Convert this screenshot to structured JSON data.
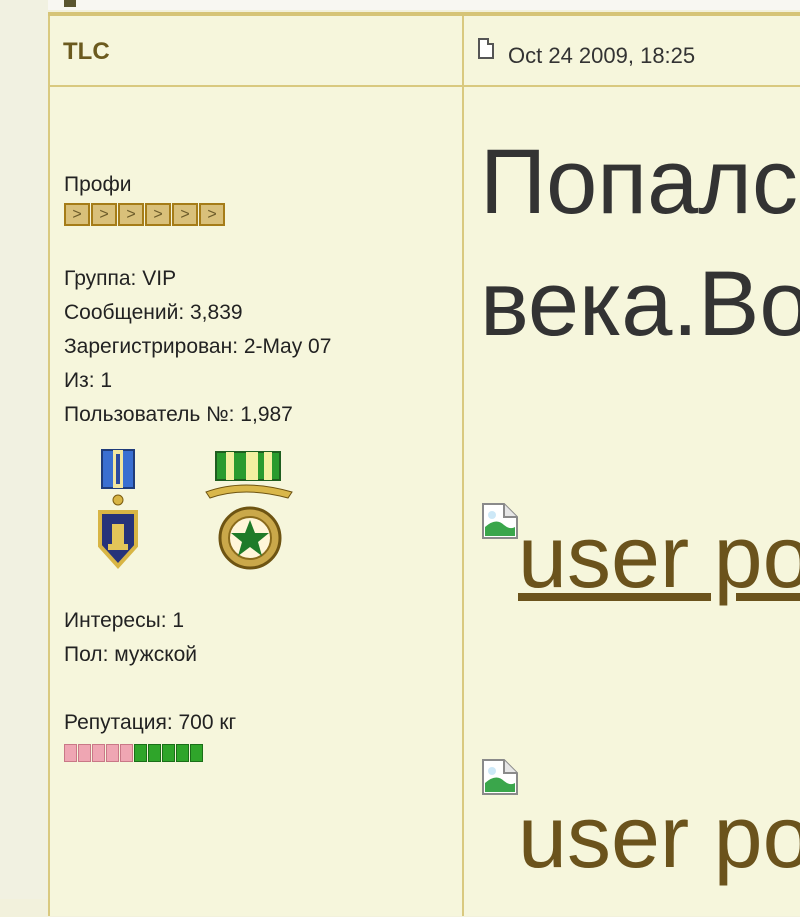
{
  "post": {
    "author": "TLC",
    "date": "Oct 24 2009, 18:25"
  },
  "profile": {
    "rank_title": "Профи",
    "rank_pips": [
      ">",
      ">",
      ">",
      ">",
      ">",
      ">"
    ],
    "group": "Группа: VIP",
    "posts": "Сообщений: 3,839",
    "registered": "Зарегистрирован: 2-May 07",
    "from": "Из: 1",
    "user_number": "Пользователь №: 1,987",
    "medals": [
      "medal-blue-shield-icon",
      "medal-green-saber-icon"
    ],
    "interests": "Интересы: 1",
    "gender": "Пол: мужской",
    "reputation": "Репутация: 700 кг",
    "reputation_bar": {
      "negative": 5,
      "positive": 5
    }
  },
  "content": {
    "text_line1": "Попалс",
    "text_line2": "века.Во",
    "image1_alt": "user po",
    "image2_alt": "user po"
  },
  "colors": {
    "background": "#f6f6dc",
    "border": "#d9c97f",
    "author": "#6b5a1e",
    "link": "#6b531c"
  }
}
